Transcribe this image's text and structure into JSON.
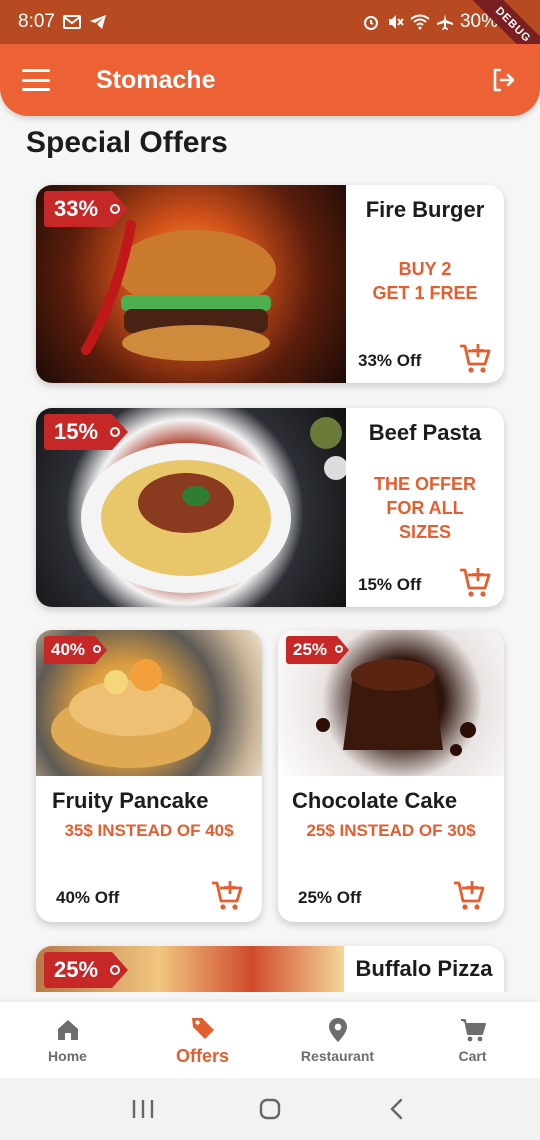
{
  "status_bar": {
    "time": "8:07",
    "battery": "30%",
    "debug_label": "DEBUG"
  },
  "app_bar": {
    "title": "Stomache"
  },
  "section_title": "Special Offers",
  "offers": [
    {
      "name": "Fire Burger",
      "badge": "33%",
      "offer_line1": "BUY 2",
      "offer_line2": "GET 1 FREE",
      "off_label": "33% Off"
    },
    {
      "name": "Beef Pasta",
      "badge": "15%",
      "offer_line1": "THE OFFER",
      "offer_line2": "FOR ALL",
      "offer_line3": "SIZES",
      "off_label": "15% Off"
    },
    {
      "name": "Fruity Pancake",
      "badge": "40%",
      "price": "35$ INSTEAD OF 40$",
      "off_label": "40% Off"
    },
    {
      "name": "Chocolate Cake",
      "badge": "25%",
      "price": "25$ INSTEAD OF 30$",
      "off_label": "25% Off"
    },
    {
      "name": "Buffalo Pizza",
      "badge": "25%"
    }
  ],
  "bottom_nav": [
    {
      "label": "Home",
      "icon": "home-icon"
    },
    {
      "label": "Offers",
      "icon": "tag-icon",
      "active": true
    },
    {
      "label": "Restaurant",
      "icon": "location-pin-icon"
    },
    {
      "label": "Cart",
      "icon": "cart-icon"
    }
  ],
  "colors": {
    "primary": "#ec6234",
    "accent_text": "#e45e30",
    "badge": "#c62828",
    "status_bar": "#b84a22"
  }
}
